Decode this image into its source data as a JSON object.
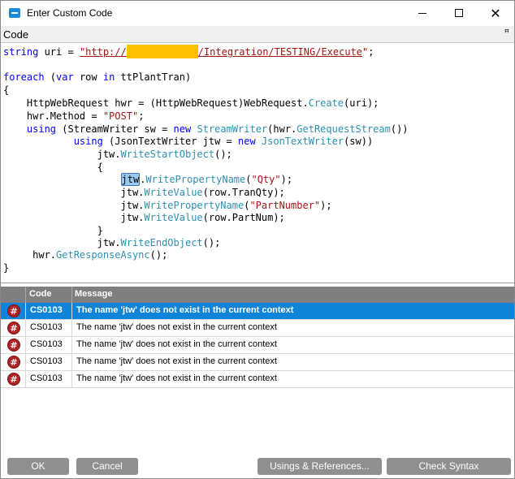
{
  "window": {
    "title": "Enter Custom Code",
    "icon": "app-window-icon",
    "min_icon": "minimize-icon",
    "max_icon": "maximize-icon",
    "close_glyph": "✕"
  },
  "code_panel": {
    "label": "Code",
    "pin_glyph": "📌"
  },
  "code": {
    "l1_a": "string",
    "l1_b": " uri = ",
    "l1_c": "\"http://",
    "l1_d": "/Integration/TESTING/Execute",
    "l1_e": "\"",
    "l1_f": ";",
    "l3_a": "foreach",
    "l3_b": " (",
    "l3_c": "var",
    "l3_d": " row ",
    "l3_e": "in",
    "l3_f": " ttPlantTran)",
    "l4": "{",
    "l5_a": "    HttpWebRequest hwr = (HttpWebRequest)WebRequest.",
    "l5_b": "Create",
    "l5_c": "(uri);",
    "l6_a": "    hwr.Method = ",
    "l6_b": "\"POST\"",
    "l6_c": ";",
    "l7_a": "    ",
    "l7_b": "using",
    "l7_c": " (StreamWriter sw = ",
    "l7_d": "new",
    "l7_e": " StreamWriter",
    "l7_f": "(hwr.",
    "l7_g": "GetRequestStream",
    "l7_h": "())",
    "l8_a": "            ",
    "l8_b": "using",
    "l8_c": " (JsonTextWriter jtw = ",
    "l8_d": "new",
    "l8_e": " JsonTextWriter",
    "l8_f": "(sw))",
    "l9_a": "                jtw.",
    "l9_b": "WriteStartObject",
    "l9_c": "();",
    "l10": "                {",
    "l11_a": "                    ",
    "l11_b": "jtw",
    "l11_c": ".",
    "l11_d": "WritePropertyName",
    "l11_e": "(",
    "l11_f": "\"Qty\"",
    "l11_g": ");",
    "l12_a": "                    jtw.",
    "l12_b": "WriteValue",
    "l12_c": "(row.TranQty);",
    "l13_a": "                    jtw.",
    "l13_b": "WritePropertyName",
    "l13_c": "(",
    "l13_d": "\"PartNumber\"",
    "l13_e": ");",
    "l14_a": "                    jtw.",
    "l14_b": "WriteValue",
    "l14_c": "(row.PartNum);",
    "l15": "                }",
    "l16_a": "                jtw.",
    "l16_b": "WriteEndObject",
    "l16_c": "();",
    "l17_a": "     hwr.",
    "l17_b": "GetResponseAsync",
    "l17_c": "();",
    "l18": "}"
  },
  "errors": {
    "columns": {
      "code": "Code",
      "message": "Message"
    },
    "icon_glyph": "#",
    "rows": [
      {
        "code": "CS0103",
        "message": "The name 'jtw' does not exist in the current context"
      },
      {
        "code": "CS0103",
        "message": "The name 'jtw' does not exist in the current context"
      },
      {
        "code": "CS0103",
        "message": "The name 'jtw' does not exist in the current context"
      },
      {
        "code": "CS0103",
        "message": "The name 'jtw' does not exist in the current context"
      },
      {
        "code": "CS0103",
        "message": "The name 'jtw' does not exist in the current context"
      }
    ]
  },
  "buttons": {
    "ok": "OK",
    "cancel": "Cancel",
    "using": "Usings & References...",
    "check": "Check Syntax"
  },
  "colors": {
    "accent": "#0f84d8",
    "error_icon": "#b22222",
    "button": "#8f8f8f",
    "keyword": "#0000ff",
    "string": "#a31515",
    "method": "#2b91af",
    "redaction": "#ffc000"
  }
}
